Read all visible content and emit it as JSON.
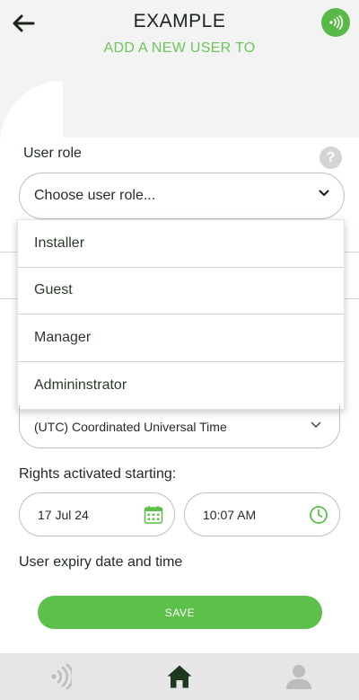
{
  "header": {
    "title": "EXAMPLE",
    "subtitle": "ADD A NEW USER TO"
  },
  "form": {
    "user_role_label": "User role",
    "user_role_placeholder": "Choose user role...",
    "role_options": [
      "Installer",
      "Guest",
      "Manager",
      "Admininstrator"
    ],
    "timezone_value": "(UTC) Coordinated Universal Time",
    "rights_label": "Rights activated starting:",
    "start_date": "17 Jul 24",
    "start_time": "10:07 AM",
    "expiry_label": "User expiry date and time",
    "save_label": "SAVE"
  },
  "colors": {
    "accent": "#5cc04b",
    "subtitle_green": "#6cc45a",
    "dark_green": "#1e3a1e"
  },
  "icons": {
    "back": "arrow-left-icon",
    "nfc": "nfc-icon",
    "help": "help-icon",
    "calendar": "calendar-icon",
    "clock": "clock-icon",
    "nav": [
      "nfc-icon",
      "home-icon",
      "user-icon"
    ]
  }
}
